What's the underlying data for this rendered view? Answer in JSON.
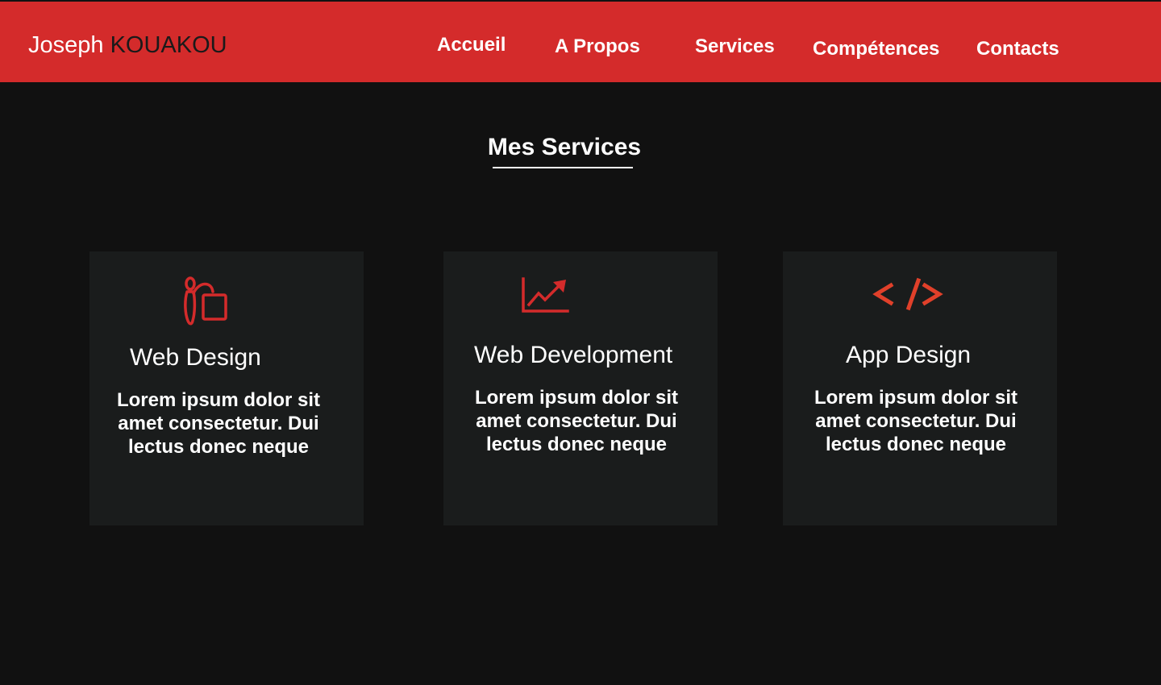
{
  "header": {
    "brand_first": "Joseph",
    "brand_last": "KOUAKOU",
    "nav": [
      {
        "label": "Accueil"
      },
      {
        "label": "A Propos"
      },
      {
        "label": "Services"
      },
      {
        "label": "Compétences"
      },
      {
        "label": "Contacts"
      }
    ]
  },
  "section": {
    "title": "Mes Services"
  },
  "cards": [
    {
      "icon": "paint-brush-icon",
      "title": "Web Design",
      "lines": [
        "Lorem ipsum dolor sit",
        "amet consectetur. Dui",
        "lectus donec neque"
      ]
    },
    {
      "icon": "line-chart-icon",
      "title": "Web Development",
      "lines": [
        "Lorem ipsum dolor sit",
        "amet consectetur. Dui",
        "lectus donec neque"
      ]
    },
    {
      "icon": "code-icon",
      "title": "App  Design",
      "icon_text": "< />",
      "lines": [
        "Lorem ipsum dolor sit",
        "amet consectetur. Dui",
        "lectus donec neque"
      ]
    }
  ],
  "colors": {
    "accent": "#d42b2b",
    "background": "#111111",
    "card": "#1a1c1c",
    "code_icon": "#e0402a"
  }
}
